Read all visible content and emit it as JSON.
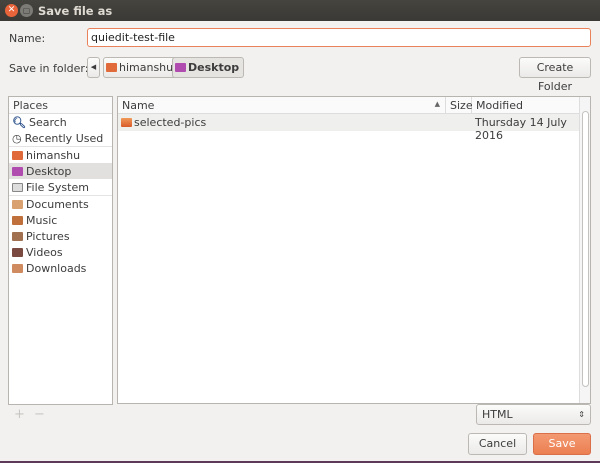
{
  "window": {
    "title": "Save file as"
  },
  "name": {
    "label": "Name:",
    "value": "quiedit-test-file"
  },
  "folder": {
    "label": "Save in folder:",
    "path": [
      "himanshu",
      "Desktop"
    ],
    "create_folder": "Create Folder"
  },
  "places": {
    "header": "Places",
    "items": [
      {
        "label": "Search",
        "icon": "search-icon"
      },
      {
        "label": "Recently Used",
        "icon": "clock-icon"
      },
      {
        "label": "himanshu",
        "icon": "home-folder-icon"
      },
      {
        "label": "Desktop",
        "icon": "desktop-icon",
        "selected": true
      },
      {
        "label": "File System",
        "icon": "drive-icon"
      },
      {
        "label": "Documents",
        "icon": "documents-icon"
      },
      {
        "label": "Music",
        "icon": "music-icon"
      },
      {
        "label": "Pictures",
        "icon": "pictures-icon"
      },
      {
        "label": "Videos",
        "icon": "videos-icon"
      },
      {
        "label": "Downloads",
        "icon": "downloads-icon"
      }
    ],
    "add": "+",
    "remove": "−"
  },
  "files": {
    "columns": {
      "name": "Name",
      "size": "Size",
      "modified": "Modified"
    },
    "rows": [
      {
        "name": "selected-pics",
        "size": "",
        "modified": "Thursday 14 July 2016"
      }
    ]
  },
  "filter": {
    "value": "HTML"
  },
  "buttons": {
    "cancel": "Cancel",
    "save": "Save"
  },
  "colors": {
    "accent": "#e9825a",
    "save": "#f0875e",
    "titlebar": "#3c3b37"
  }
}
